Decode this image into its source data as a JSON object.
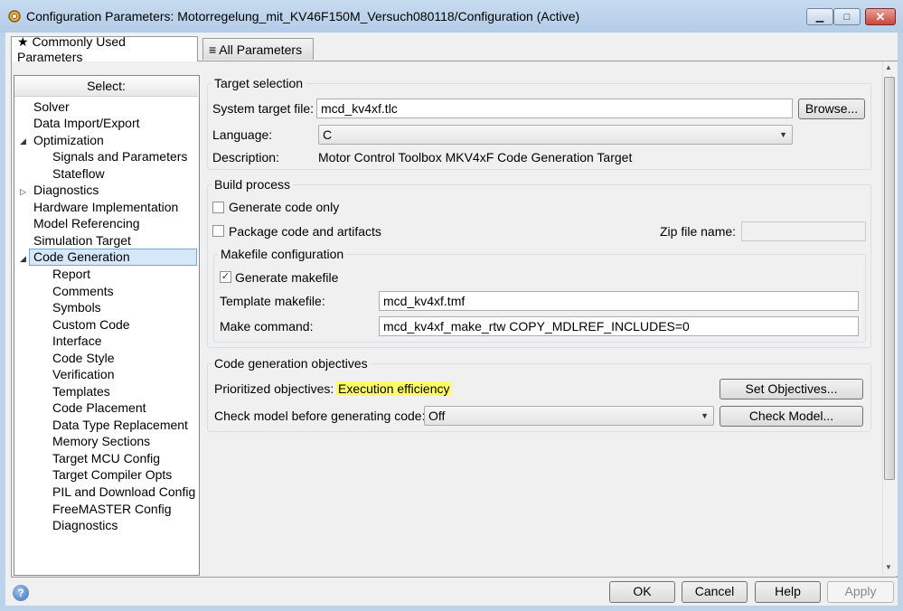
{
  "window": {
    "title": "Configuration Parameters: Motorregelung_mit_KV46F150M_Versuch080118/Configuration (Active)",
    "min_glyph": "▁",
    "max_glyph": "□",
    "close_glyph": "✕"
  },
  "tabs": [
    {
      "label": "★ Commonly Used Parameters"
    },
    {
      "label": "≡ All Parameters"
    }
  ],
  "tree": {
    "header": "Select:",
    "items": [
      {
        "label": "Solver"
      },
      {
        "label": "Data Import/Export"
      },
      {
        "label": "Optimization"
      },
      {
        "label": "Signals and Parameters"
      },
      {
        "label": "Stateflow"
      },
      {
        "label": "Diagnostics"
      },
      {
        "label": "Hardware Implementation"
      },
      {
        "label": "Model Referencing"
      },
      {
        "label": "Simulation Target"
      },
      {
        "label": "Code Generation"
      },
      {
        "label": "Report"
      },
      {
        "label": "Comments"
      },
      {
        "label": "Symbols"
      },
      {
        "label": "Custom Code"
      },
      {
        "label": "Interface"
      },
      {
        "label": "Code Style"
      },
      {
        "label": "Verification"
      },
      {
        "label": "Templates"
      },
      {
        "label": "Code Placement"
      },
      {
        "label": "Data Type Replacement"
      },
      {
        "label": "Memory Sections"
      },
      {
        "label": "Target MCU Config"
      },
      {
        "label": "Target Compiler Opts"
      },
      {
        "label": "PIL and Download Config"
      },
      {
        "label": "FreeMASTER Config"
      },
      {
        "label": "Diagnostics"
      }
    ],
    "selected": "Code Generation"
  },
  "target_selection": {
    "title": "Target selection",
    "system_target_label": "System target file:",
    "system_target_value": "mcd_kv4xf.tlc",
    "browse_label": "Browse...",
    "language_label": "Language:",
    "language_value": "C",
    "description_label": "Description:",
    "description_value": "Motor Control Toolbox MKV4xF Code Generation Target"
  },
  "build_process": {
    "title": "Build process",
    "generate_code_only_label": "Generate code only",
    "generate_code_only_checked": false,
    "package_label": "Package code and artifacts",
    "package_checked": false,
    "zip_label": "Zip file name:",
    "zip_value": "",
    "makefile": {
      "title": "Makefile configuration",
      "generate_makefile_label": "Generate makefile",
      "generate_makefile_checked": true,
      "template_label": "Template makefile:",
      "template_value": "mcd_kv4xf.tmf",
      "make_command_label": "Make command:",
      "make_command_value": "mcd_kv4xf_make_rtw COPY_MDLREF_INCLUDES=0"
    }
  },
  "objectives": {
    "title": "Code generation objectives",
    "prioritized_label": "Prioritized objectives:",
    "prioritized_value": "Execution efficiency",
    "highlight_color": "#ffff66",
    "set_objectives_label": "Set Objectives...",
    "check_model_label": "Check model before generating code:",
    "check_model_value": "Off",
    "check_model_button": "Check Model..."
  },
  "footer": {
    "help_icon": "?",
    "ok": "OK",
    "cancel": "Cancel",
    "help": "Help",
    "apply": "Apply"
  },
  "icons": {
    "app": "config-gear-icon",
    "expand_open": "▲",
    "expand_closed": "▷",
    "checkmark": "✓",
    "dropdown": "▼",
    "scroll_up": "▲",
    "scroll_down": "▼"
  }
}
